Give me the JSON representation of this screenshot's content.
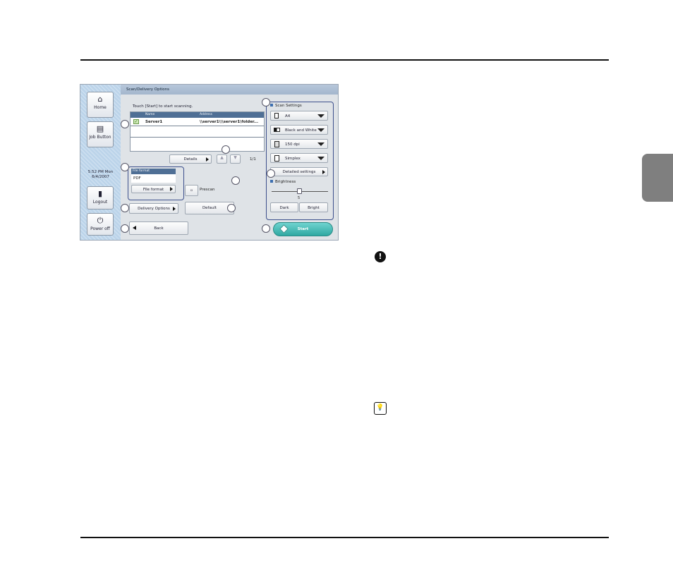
{
  "screen": {
    "title": "Scan/Delivery Options",
    "instruction": "Touch [Start] to start scanning.",
    "sidebar": {
      "home": "Home",
      "job_button": "Job Button",
      "time": "5:52 PM Mon",
      "date": "6/4/2007",
      "logout": "Logout",
      "power_off": "Power off"
    },
    "list": {
      "col_name": "Name",
      "col_address": "Address",
      "rows": [
        {
          "name": "Server1",
          "address": "\\\\server1\\\\\\server1\\folder..."
        }
      ]
    },
    "details_label": "Details",
    "page_indicator": "1/1",
    "file_format": {
      "header": "File format",
      "value": "PDF",
      "button": "File format"
    },
    "prescan_label": "Prescan",
    "delivery_options_label": "Delivery Options",
    "default_label": "Default",
    "back_label": "Back",
    "scan_settings": {
      "title": "Scan Settings",
      "paper_size": "A4",
      "color_mode": "Black and White",
      "resolution": "150 dpi",
      "sides": "Simplex",
      "detailed_settings": "Detailed settings",
      "brightness_title": "Brightness",
      "brightness_value": "5",
      "dark_label": "Dark",
      "bright_label": "Bright"
    },
    "start_label": "Start"
  },
  "icons": {
    "important": "exclamation-icon",
    "hint": "lightbulb-icon"
  }
}
